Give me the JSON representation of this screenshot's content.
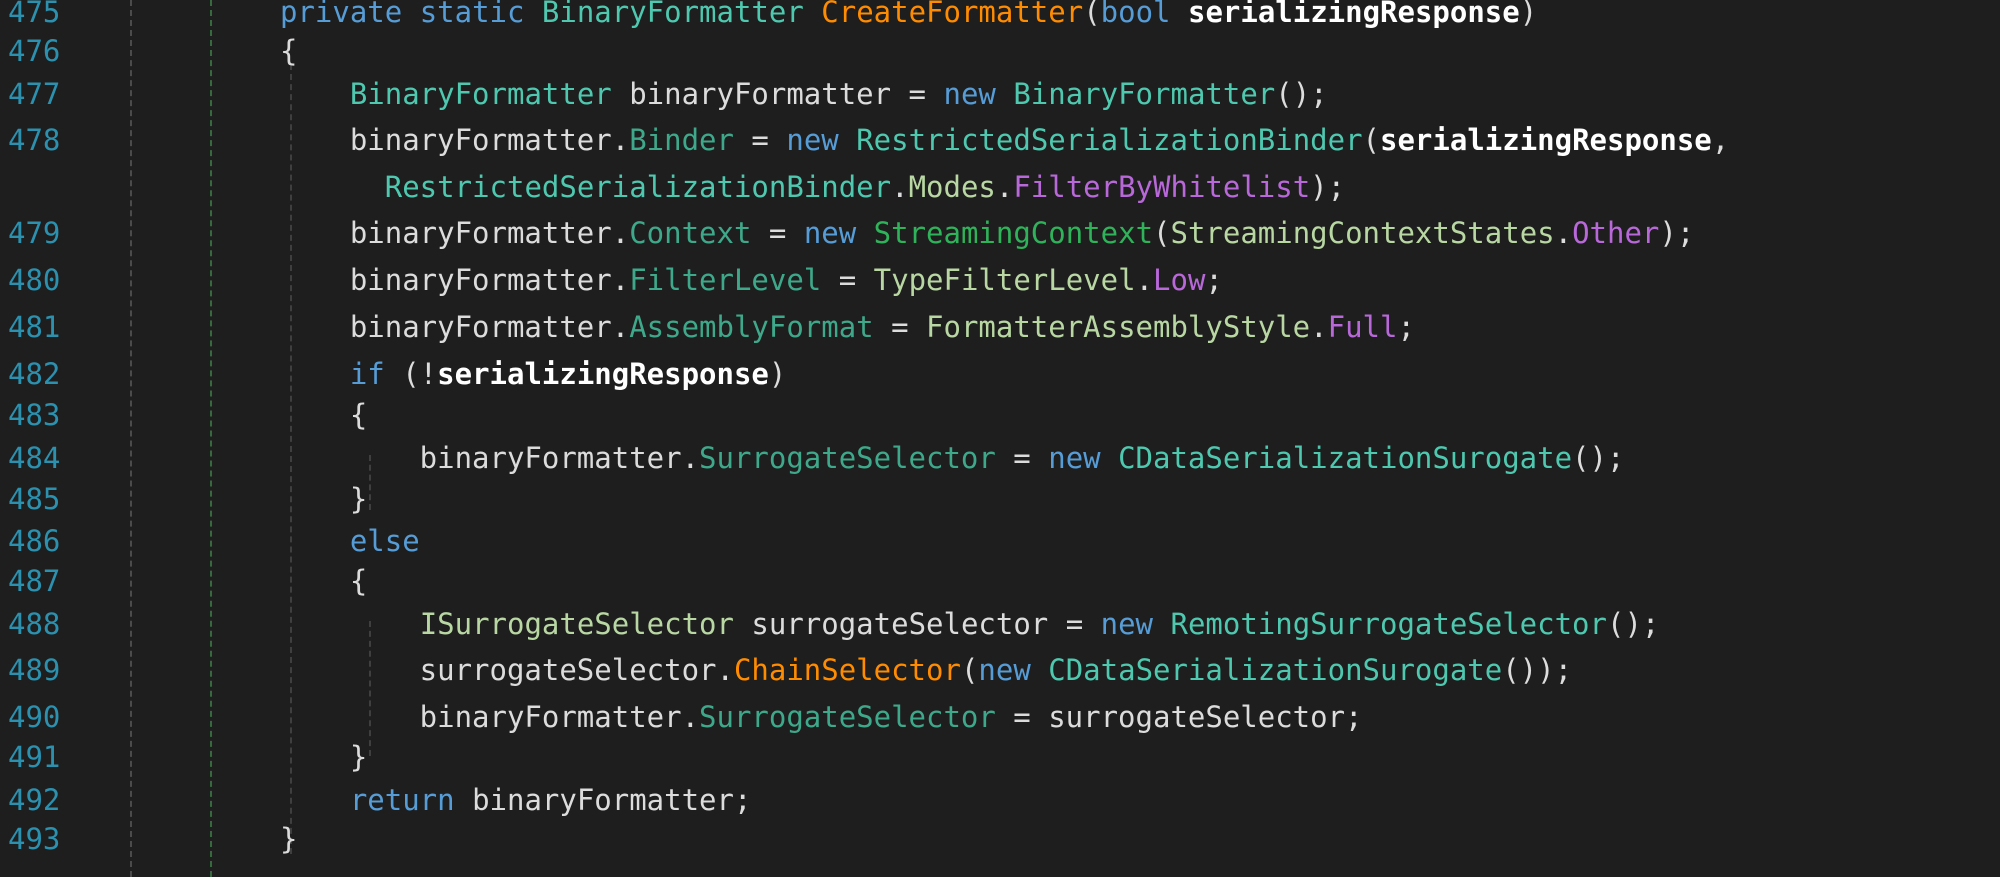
{
  "editor": {
    "lines": [
      {
        "number": "475",
        "tokens": [
          {
            "t": "private",
            "c": "kw"
          },
          {
            "t": " ",
            "c": "plain"
          },
          {
            "t": "static",
            "c": "kw"
          },
          {
            "t": " ",
            "c": "plain"
          },
          {
            "t": "BinaryFormatter",
            "c": "type"
          },
          {
            "t": " ",
            "c": "plain"
          },
          {
            "t": "CreateFormatter",
            "c": "meth"
          },
          {
            "t": "(",
            "c": "plain"
          },
          {
            "t": "bool",
            "c": "kw"
          },
          {
            "t": " ",
            "c": "plain"
          },
          {
            "t": "serializingResponse",
            "c": "param"
          },
          {
            "t": ")",
            "c": "plain"
          }
        ]
      },
      {
        "number": "476",
        "tokens": [
          {
            "t": "{",
            "c": "plain"
          }
        ]
      },
      {
        "number": "477",
        "tokens": [
          {
            "t": "    ",
            "c": "plain"
          },
          {
            "t": "BinaryFormatter",
            "c": "type"
          },
          {
            "t": " binaryFormatter = ",
            "c": "plain"
          },
          {
            "t": "new",
            "c": "kw"
          },
          {
            "t": " ",
            "c": "plain"
          },
          {
            "t": "BinaryFormatter",
            "c": "type"
          },
          {
            "t": "();",
            "c": "plain"
          }
        ]
      },
      {
        "number": "478",
        "tokens": [
          {
            "t": "    binaryFormatter.",
            "c": "plain"
          },
          {
            "t": "Binder",
            "c": "prop"
          },
          {
            "t": " = ",
            "c": "plain"
          },
          {
            "t": "new",
            "c": "kw"
          },
          {
            "t": " ",
            "c": "plain"
          },
          {
            "t": "RestrictedSerializationBinder",
            "c": "type"
          },
          {
            "t": "(",
            "c": "plain"
          },
          {
            "t": "serializingResponse",
            "c": "param"
          },
          {
            "t": ",",
            "c": "plain"
          }
        ]
      },
      {
        "number": "",
        "tokens": [
          {
            "t": "      ",
            "c": "plain"
          },
          {
            "t": "RestrictedSerializationBinder",
            "c": "type"
          },
          {
            "t": ".",
            "c": "plain"
          },
          {
            "t": "Modes",
            "c": "enumt"
          },
          {
            "t": ".",
            "c": "plain"
          },
          {
            "t": "FilterByWhitelist",
            "c": "enumv"
          },
          {
            "t": ");",
            "c": "plain"
          }
        ]
      },
      {
        "number": "479",
        "tokens": [
          {
            "t": "    binaryFormatter.",
            "c": "plain"
          },
          {
            "t": "Context",
            "c": "prop"
          },
          {
            "t": " = ",
            "c": "plain"
          },
          {
            "t": "new",
            "c": "kw"
          },
          {
            "t": " ",
            "c": "plain"
          },
          {
            "t": "StreamingContext",
            "c": "cls2"
          },
          {
            "t": "(",
            "c": "plain"
          },
          {
            "t": "StreamingContextStates",
            "c": "enumt"
          },
          {
            "t": ".",
            "c": "plain"
          },
          {
            "t": "Other",
            "c": "enumv"
          },
          {
            "t": ");",
            "c": "plain"
          }
        ]
      },
      {
        "number": "480",
        "tokens": [
          {
            "t": "    binaryFormatter.",
            "c": "plain"
          },
          {
            "t": "FilterLevel",
            "c": "prop"
          },
          {
            "t": " = ",
            "c": "plain"
          },
          {
            "t": "TypeFilterLevel",
            "c": "enumt"
          },
          {
            "t": ".",
            "c": "plain"
          },
          {
            "t": "Low",
            "c": "enumv"
          },
          {
            "t": ";",
            "c": "plain"
          }
        ]
      },
      {
        "number": "481",
        "tokens": [
          {
            "t": "    binaryFormatter.",
            "c": "plain"
          },
          {
            "t": "AssemblyFormat",
            "c": "prop"
          },
          {
            "t": " = ",
            "c": "plain"
          },
          {
            "t": "FormatterAssemblyStyle",
            "c": "enumt"
          },
          {
            "t": ".",
            "c": "plain"
          },
          {
            "t": "Full",
            "c": "enumv"
          },
          {
            "t": ";",
            "c": "plain"
          }
        ]
      },
      {
        "number": "482",
        "tokens": [
          {
            "t": "    ",
            "c": "plain"
          },
          {
            "t": "if",
            "c": "kw"
          },
          {
            "t": " (!",
            "c": "plain"
          },
          {
            "t": "serializingResponse",
            "c": "param"
          },
          {
            "t": ")",
            "c": "plain"
          }
        ]
      },
      {
        "number": "483",
        "tokens": [
          {
            "t": "    {",
            "c": "plain"
          }
        ]
      },
      {
        "number": "484",
        "tokens": [
          {
            "t": "        binaryFormatter.",
            "c": "plain"
          },
          {
            "t": "SurrogateSelector",
            "c": "prop"
          },
          {
            "t": " = ",
            "c": "plain"
          },
          {
            "t": "new",
            "c": "kw"
          },
          {
            "t": " ",
            "c": "plain"
          },
          {
            "t": "CDataSerializationSurogate",
            "c": "type"
          },
          {
            "t": "();",
            "c": "plain"
          }
        ]
      },
      {
        "number": "485",
        "tokens": [
          {
            "t": "    }",
            "c": "plain"
          }
        ]
      },
      {
        "number": "486",
        "tokens": [
          {
            "t": "    ",
            "c": "plain"
          },
          {
            "t": "else",
            "c": "kw"
          }
        ]
      },
      {
        "number": "487",
        "tokens": [
          {
            "t": "    {",
            "c": "plain"
          }
        ]
      },
      {
        "number": "488",
        "tokens": [
          {
            "t": "        ",
            "c": "plain"
          },
          {
            "t": "ISurrogateSelector",
            "c": "iface"
          },
          {
            "t": " surrogateSelector = ",
            "c": "plain"
          },
          {
            "t": "new",
            "c": "kw"
          },
          {
            "t": " ",
            "c": "plain"
          },
          {
            "t": "RemotingSurrogateSelector",
            "c": "type"
          },
          {
            "t": "();",
            "c": "plain"
          }
        ]
      },
      {
        "number": "489",
        "tokens": [
          {
            "t": "        surrogateSelector.",
            "c": "plain"
          },
          {
            "t": "ChainSelector",
            "c": "meth"
          },
          {
            "t": "(",
            "c": "plain"
          },
          {
            "t": "new",
            "c": "kw"
          },
          {
            "t": " ",
            "c": "plain"
          },
          {
            "t": "CDataSerializationSurogate",
            "c": "type"
          },
          {
            "t": "());",
            "c": "plain"
          }
        ]
      },
      {
        "number": "490",
        "tokens": [
          {
            "t": "        binaryFormatter.",
            "c": "plain"
          },
          {
            "t": "SurrogateSelector",
            "c": "prop"
          },
          {
            "t": " = surrogateSelector;",
            "c": "plain"
          }
        ]
      },
      {
        "number": "491",
        "tokens": [
          {
            "t": "    }",
            "c": "plain"
          }
        ]
      },
      {
        "number": "492",
        "tokens": [
          {
            "t": "    ",
            "c": "plain"
          },
          {
            "t": "return",
            "c": "kw"
          },
          {
            "t": " binaryFormatter;",
            "c": "plain"
          }
        ]
      },
      {
        "number": "493",
        "tokens": [
          {
            "t": "}",
            "c": "plain"
          }
        ]
      }
    ]
  }
}
